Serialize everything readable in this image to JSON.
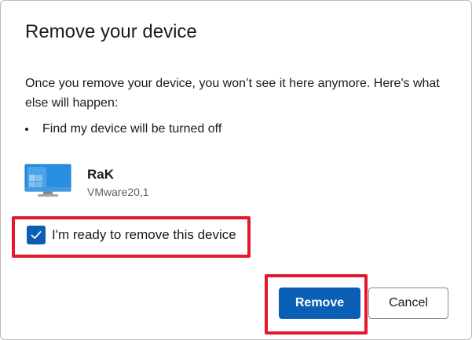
{
  "dialog": {
    "title": "Remove your device",
    "description": "Once you remove your device, you won’t see it here anymore. Here's what else will happen:",
    "bullets": [
      "Find my device will be turned off"
    ],
    "device": {
      "name": "RaK",
      "model": "VMware20,1",
      "icon": "monitor-icon"
    },
    "checkbox": {
      "label": "I'm ready to remove this device",
      "checked": true
    },
    "buttons": {
      "remove_label": "Remove",
      "cancel_label": "Cancel"
    },
    "colors": {
      "accent": "#0a5fb4",
      "highlight": "#e3192b"
    }
  }
}
